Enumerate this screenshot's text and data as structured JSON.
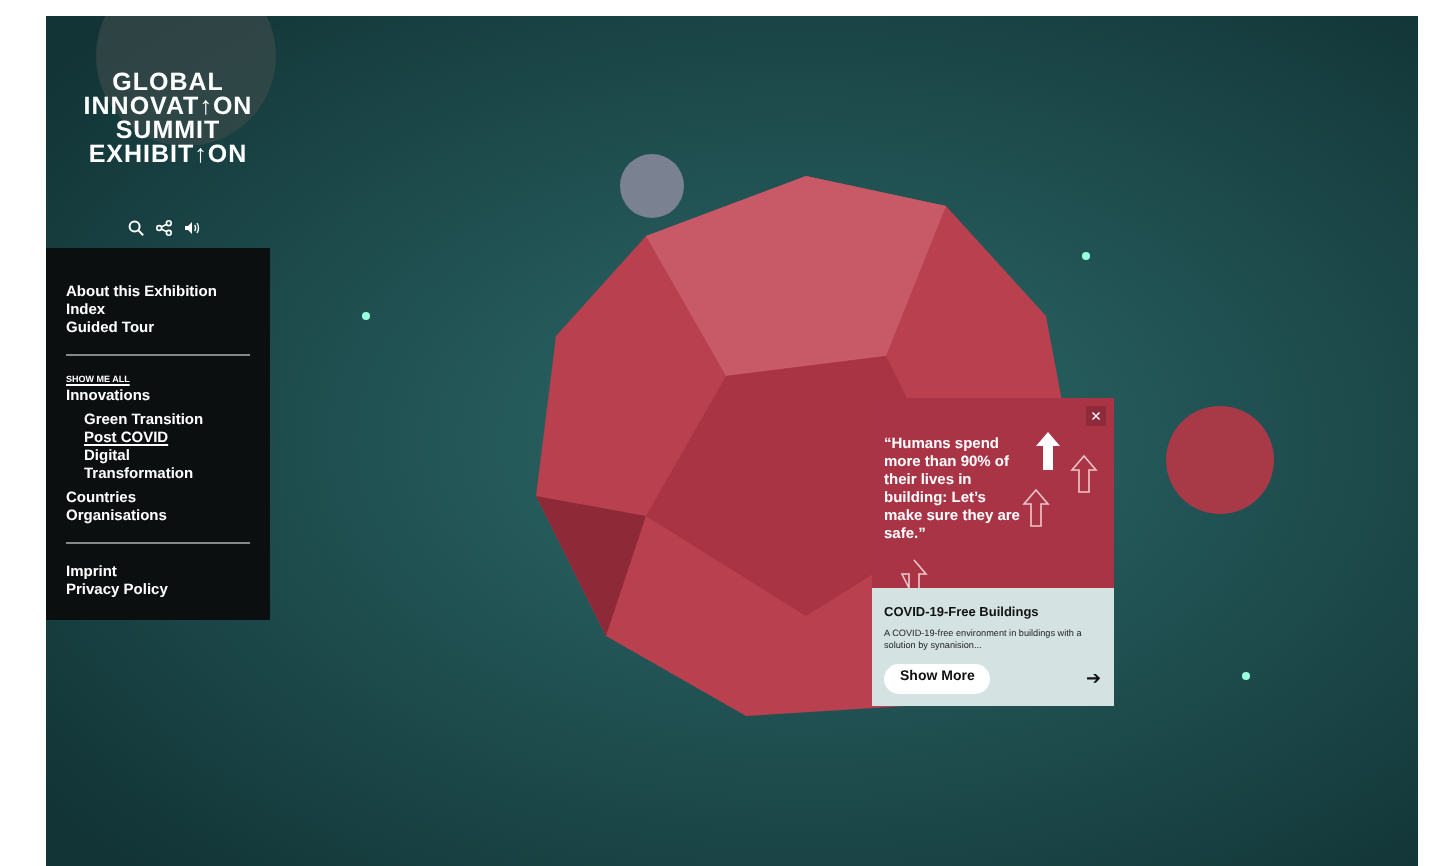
{
  "logo": {
    "lines": [
      "GLOBAL",
      "INNOVAT↑ON",
      "SUMMIT",
      "EXHIBIT↑ON"
    ]
  },
  "toolbar": [
    {
      "kind": "search"
    },
    {
      "kind": "share"
    },
    {
      "kind": "sound"
    }
  ],
  "menu": {
    "top": [
      "About this Exhibition",
      "Index",
      "Guided Tour"
    ],
    "show_all": "SHOW ME ALL",
    "innovations": {
      "label": "Innovations",
      "children": [
        {
          "label": "Green Transition",
          "selected": false
        },
        {
          "label": "Post COVID",
          "selected": true
        },
        {
          "label": "Digital Transformation",
          "selected": false
        }
      ]
    },
    "more": [
      "Countries",
      "Organisations"
    ],
    "footer": [
      "Imprint",
      "Privacy Policy"
    ]
  },
  "popup": {
    "quote": "“Humans spend more than 90% of their lives in building: Let’s make sure they are safe.”",
    "close": "×",
    "title": "COVID-19-Free Buildings",
    "description": "A COVID-19-free environment in buildings with a solution by synanision...",
    "button": "Show More",
    "arrow": "➔"
  }
}
